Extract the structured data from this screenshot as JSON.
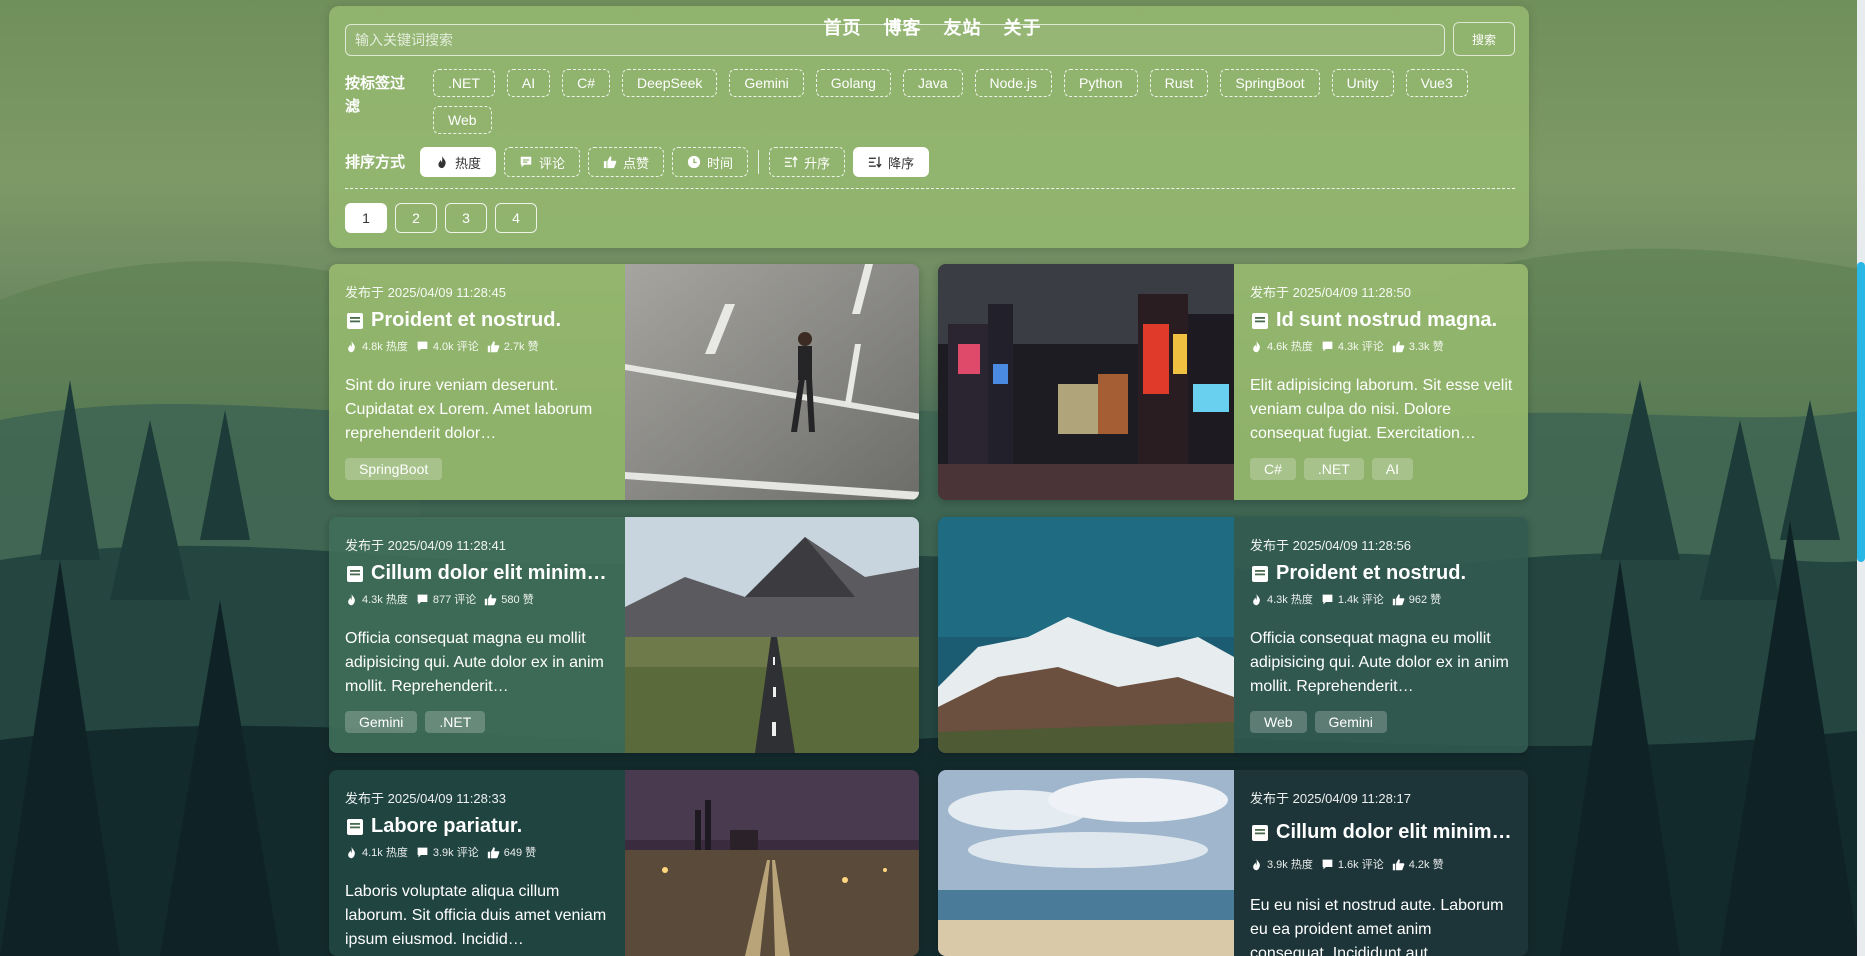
{
  "nav": {
    "items": [
      "首页",
      "博客",
      "友站",
      "关于"
    ]
  },
  "search": {
    "placeholder": "输入关键词搜索",
    "button_label": "搜索"
  },
  "filter": {
    "label": "按标签过滤",
    "tags": [
      ".NET",
      "AI",
      "C#",
      "DeepSeek",
      "Gemini",
      "Golang",
      "Java",
      "Node.js",
      "Python",
      "Rust",
      "SpringBoot",
      "Unity",
      "Vue3",
      "Web"
    ]
  },
  "sort": {
    "label": "排序方式",
    "options": [
      "热度",
      "评论",
      "点赞",
      "时间"
    ],
    "order": [
      "升序",
      "降序"
    ],
    "active_option": "热度",
    "active_order": "降序"
  },
  "pager": {
    "pages": [
      "1",
      "2",
      "3",
      "4"
    ],
    "current": "1"
  },
  "posts": [
    {
      "date": "发布于 2025/04/09 11:28:45",
      "title": "Proident et nostrud.",
      "heat": "4.8k 热度",
      "comments": "4.0k 评论",
      "likes": "2.7k 赞",
      "excerpt": "Sint do irure veniam deserunt. Cupidatat ex Lorem. Amet laborum reprehenderit dolor…",
      "tags": [
        "SpringBoot"
      ]
    },
    {
      "date": "发布于 2025/04/09 11:28:50",
      "title": "Id sunt nostrud magna.",
      "heat": "4.6k 热度",
      "comments": "4.3k 评论",
      "likes": "3.3k 赞",
      "excerpt": "Elit adipisicing laborum. Sit esse velit veniam culpa do nisi. Dolore consequat fugiat. Exercitation…",
      "tags": [
        "C#",
        ".NET",
        "AI"
      ]
    },
    {
      "date": "发布于 2025/04/09 11:28:41",
      "title": "Cillum dolor elit minim…",
      "heat": "4.3k 热度",
      "comments": "877 评论",
      "likes": "580 赞",
      "excerpt": "Officia consequat magna eu mollit adipisicing qui. Aute dolor ex in anim mollit. Reprehenderit…",
      "tags": [
        "Gemini",
        ".NET"
      ]
    },
    {
      "date": "发布于 2025/04/09 11:28:56",
      "title": "Proident et nostrud.",
      "heat": "4.3k 热度",
      "comments": "1.4k 评论",
      "likes": "962 赞",
      "excerpt": "Officia consequat magna eu mollit adipisicing qui. Aute dolor ex in anim mollit. Reprehenderit…",
      "tags": [
        "Web",
        "Gemini"
      ]
    },
    {
      "date": "发布于 2025/04/09 11:28:33",
      "title": "Labore pariatur.",
      "heat": "4.1k 热度",
      "comments": "3.9k 评论",
      "likes": "649 赞",
      "excerpt": "Laboris voluptate aliqua cillum laborum. Sit officia duis amet veniam ipsum eiusmod. Incidid…",
      "tags": []
    },
    {
      "date": "发布于 2025/04/09 11:28:17",
      "title": "Cillum dolor elit minim…",
      "heat": "3.9k 热度",
      "comments": "1.6k 评论",
      "likes": "4.2k 赞",
      "excerpt": "Eu eu nisi et nostrud aute. Laborum eu ea proident amet anim consequat. Incididunt aut…",
      "tags": []
    }
  ],
  "icons": {
    "heat": "flame-icon",
    "comments": "comment-icon",
    "likes": "thumbs-up-icon",
    "time": "clock-icon",
    "doc": "document-icon"
  },
  "colors": {
    "panel": "#94b770",
    "accent_scroll": "#29b8e6"
  }
}
